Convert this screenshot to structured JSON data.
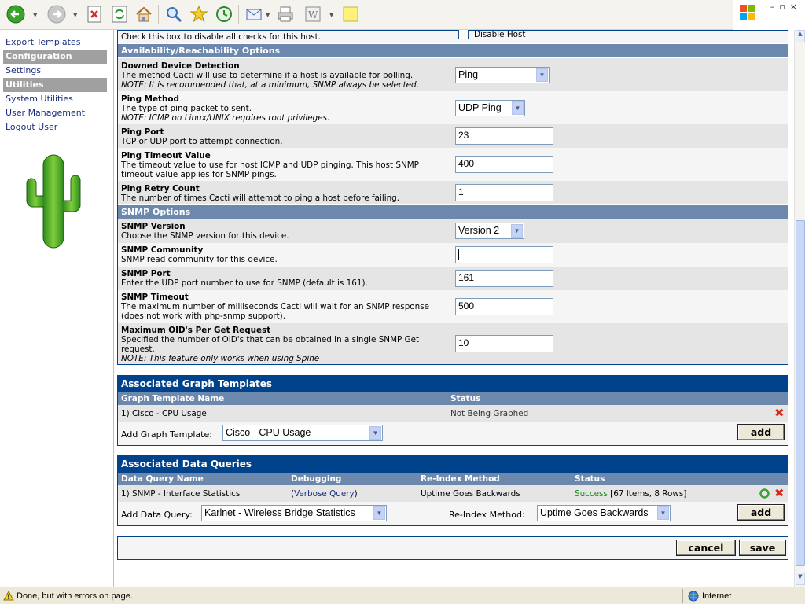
{
  "browser": {
    "status_text": "Done, but with errors on page.",
    "zone": "Internet"
  },
  "nav": {
    "items": [
      {
        "label": "Export Templates",
        "type": "link"
      },
      {
        "label": "Configuration",
        "type": "header"
      },
      {
        "label": "Settings",
        "type": "link"
      },
      {
        "label": "Utilities",
        "type": "header"
      },
      {
        "label": "System Utilities",
        "type": "link"
      },
      {
        "label": "User Management",
        "type": "link"
      },
      {
        "label": "Logout User",
        "type": "link"
      }
    ]
  },
  "host": {
    "disable_desc": "Check this box to disable all checks for this host.",
    "disable_label": "Disable Host",
    "availability_section": "Availability/Reachability Options",
    "downed": {
      "title": "Downed Device Detection",
      "desc": "The method Cacti will use to determine if a host is available for polling.",
      "note": "NOTE: It is recommended that, at a minimum, SNMP always be selected.",
      "value": "Ping"
    },
    "ping_method": {
      "title": "Ping Method",
      "desc": "The type of ping packet to sent.",
      "note": "NOTE: ICMP on Linux/UNIX requires root privileges.",
      "value": "UDP Ping"
    },
    "ping_port": {
      "title": "Ping Port",
      "desc": "TCP or UDP port to attempt connection.",
      "value": "23"
    },
    "ping_timeout": {
      "title": "Ping Timeout Value",
      "desc1": "The timeout value to use for host ICMP and UDP pinging. This host SNMP",
      "desc2": "timeout value applies for SNMP pings.",
      "value": "400"
    },
    "ping_retry": {
      "title": "Ping Retry Count",
      "desc": "The number of times Cacti will attempt to ping a host before failing.",
      "value": "1"
    },
    "snmp_section": "SNMP Options",
    "snmp_version": {
      "title": "SNMP Version",
      "desc": "Choose the SNMP version for this device.",
      "value": "Version 2"
    },
    "snmp_community": {
      "title": "SNMP Community",
      "desc": "SNMP read community for this device.",
      "value": ""
    },
    "snmp_port": {
      "title": "SNMP Port",
      "desc": "Enter the UDP port number to use for SNMP (default is 161).",
      "value": "161"
    },
    "snmp_timeout": {
      "title": "SNMP Timeout",
      "desc1": "The maximum number of milliseconds Cacti will wait for an SNMP response",
      "desc2": "(does not work with php-snmp support).",
      "value": "500"
    },
    "max_oid": {
      "title": "Maximum OID's Per Get Request",
      "desc1": "Specified the number of OID's that can be obtained in a single SNMP Get",
      "desc2": "request.",
      "note": "NOTE: This feature only works when using Spine",
      "value": "10"
    }
  },
  "graph_templates": {
    "title": "Associated Graph Templates",
    "col_name": "Graph Template Name",
    "col_status": "Status",
    "rows": [
      {
        "name": "1) Cisco - CPU Usage",
        "status": "Not Being Graphed"
      }
    ],
    "add_label": "Add Graph Template:",
    "add_value": "Cisco - CPU Usage",
    "add_button": "add"
  },
  "data_queries": {
    "title": "Associated Data Queries",
    "col_name": "Data Query Name",
    "col_debug": "Debugging",
    "col_reindex": "Re-Index Method",
    "col_status": "Status",
    "row": {
      "name": "1) SNMP - Interface Statistics",
      "debug_open": "(",
      "debug_link": "Verbose Query",
      "debug_close": ")",
      "reindex": "Uptime Goes Backwards",
      "status_ok": "Success",
      "status_rest": "[67 Items, 8 Rows]"
    },
    "add_label": "Add Data Query:",
    "add_value": "Karlnet - Wireless Bridge Statistics",
    "reindex_label": "Re-Index Method:",
    "reindex_value": "Uptime Goes Backwards",
    "add_button": "add"
  },
  "actions": {
    "cancel": "cancel",
    "save": "save"
  },
  "colors": {
    "header_blue": "#00438c",
    "section_blue": "#6d88ad",
    "row_grey": "#e5e5e5"
  }
}
